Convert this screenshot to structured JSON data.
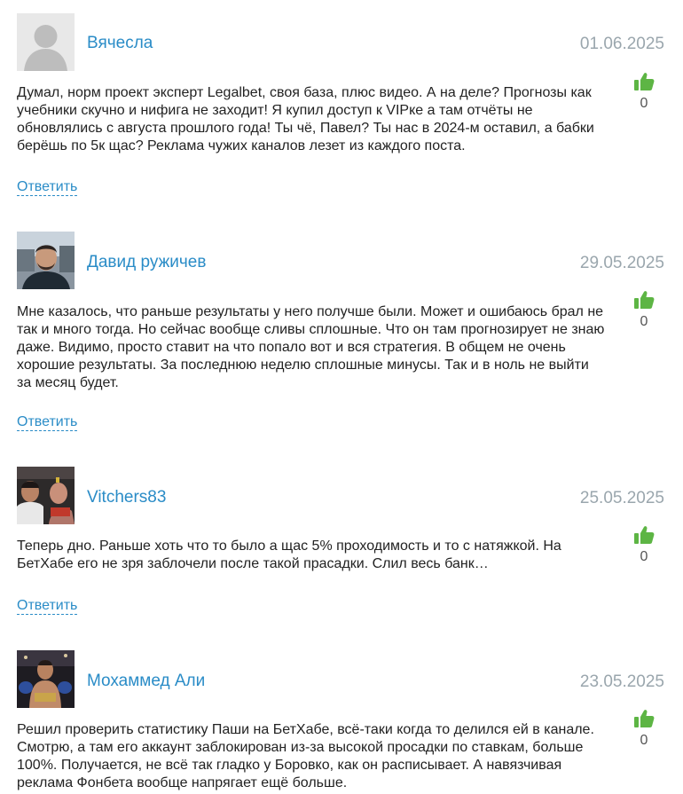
{
  "colors": {
    "author": "#2a8cc7",
    "date": "#9aa6ad",
    "thumb": "#5db544",
    "reply": "#2a8cc7"
  },
  "icons": {
    "vote": "thumbs-up-icon"
  },
  "comments": [
    {
      "author": "Вячесла",
      "date": "01.06.2025",
      "votes": "0",
      "avatar": "default-avatar",
      "text": "Думал, норм проект эксперт Legalbet, своя база, плюс видео. А на деле? Прогнозы как учебники скучно и нифига не заходит! Я купил доступ к VIPке а там отчёты не обновлялись с августа прошлого года! Ты чё, Павел? Ты нас в 2024-м оставил, а бабки берёшь по 5к щас? Реклама чужих каналов лезет из каждого поста.",
      "reply": "Ответить"
    },
    {
      "author": "Давид ружичев",
      "date": "29.05.2025",
      "votes": "0",
      "avatar": "user-photo",
      "text": "Мне казалось, что раньше результаты у него получше были. Может и ошибаюсь брал не так и много тогда. Но сейчас вообще сливы сплошные. Что он там прогнозирует не знаю даже. Видимо, просто ставит на что попало вот и вся стратегия. В общем не очень хорошие результаты. За последнюю неделю сплошные минусы. Так и в ноль не выйти за месяц будет.",
      "reply": "Ответить"
    },
    {
      "author": "Vitchers83",
      "date": "25.05.2025",
      "votes": "0",
      "avatar": "fighters-photo",
      "text": "Теперь дно. Раньше хоть что то было а щас 5% проходимость и то с натяжкой. На БетХабе его не зря заблочели после такой прасадки. Слил весь банк…",
      "reply": "Ответить"
    },
    {
      "author": "Мохаммед Али",
      "date": "23.05.2025",
      "votes": "0",
      "avatar": "boxer-photo",
      "text": "Решил проверить статистику Паши на БетХабе, всё-таки когда то делился ей в канале. Смотрю, а там его аккаунт заблокирован из-за высокой просадки по ставкам, больше 100%. Получается, не всё так гладко у Боровко, как он расписывает. А навязчивая реклама Фонбета вообще напрягает ещё больше.",
      "reply": ""
    }
  ]
}
